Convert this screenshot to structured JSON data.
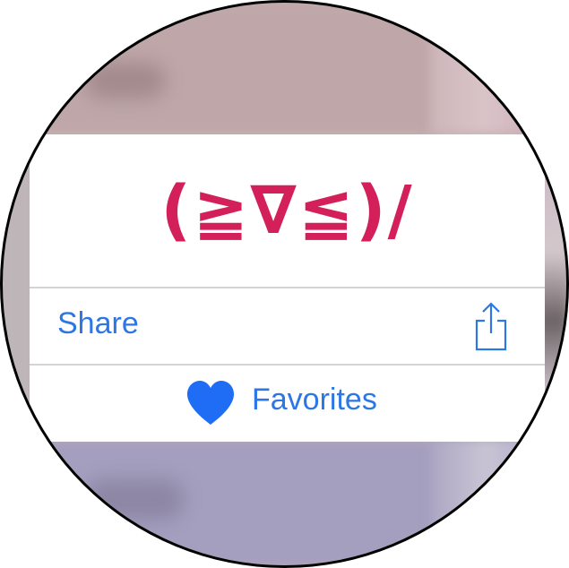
{
  "popup": {
    "emoticon": "(≧∇≦)/",
    "emoticon_color": "#d4205a"
  },
  "actions": {
    "share_label": "Share",
    "share_icon": "share-icon",
    "favorites_label": "Favorites",
    "favorites_icon": "heart-icon"
  },
  "colors": {
    "accent": "#2c76e5",
    "heart": "#1f6df5",
    "divider": "#d4d4d6"
  }
}
